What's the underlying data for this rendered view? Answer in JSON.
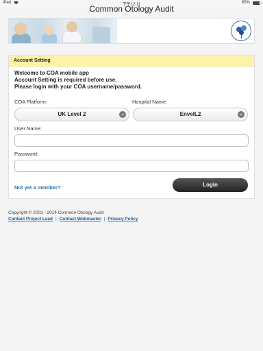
{
  "status_bar": {
    "carrier": "iPad",
    "time": "下午12:11",
    "battery_percent": "85%",
    "battery_level": 0.85,
    "icons": [
      "wifi-icon",
      "battery-icon"
    ]
  },
  "app": {
    "title": "Common Otology Audit"
  },
  "panel": {
    "header": "Account Setting",
    "welcome_lines": [
      "Welcome to COA mobile app",
      "Account Setting is required before use.",
      "Please login with your COA username/password."
    ],
    "platform_label": "COA Platform:",
    "platform_value": "UK Level 2",
    "hospital_label": "Hospital Name:",
    "hospital_value": "EnvelL2",
    "username_label": "User Name:",
    "username_value": "",
    "password_label": "Password:",
    "password_value": "",
    "not_member_link": "Not yet a member?",
    "login_button": "Login"
  },
  "footer": {
    "copyright": "Copyright © 2003 - 2014 Common Otology Audit",
    "links": [
      "Contact Project Lead",
      "Contact Webmaster",
      "Privacy Policy"
    ],
    "separator": "|"
  },
  "colors": {
    "header_bg": "#fdf2a8",
    "link": "#2a6fb8",
    "login_button": "#333333"
  }
}
